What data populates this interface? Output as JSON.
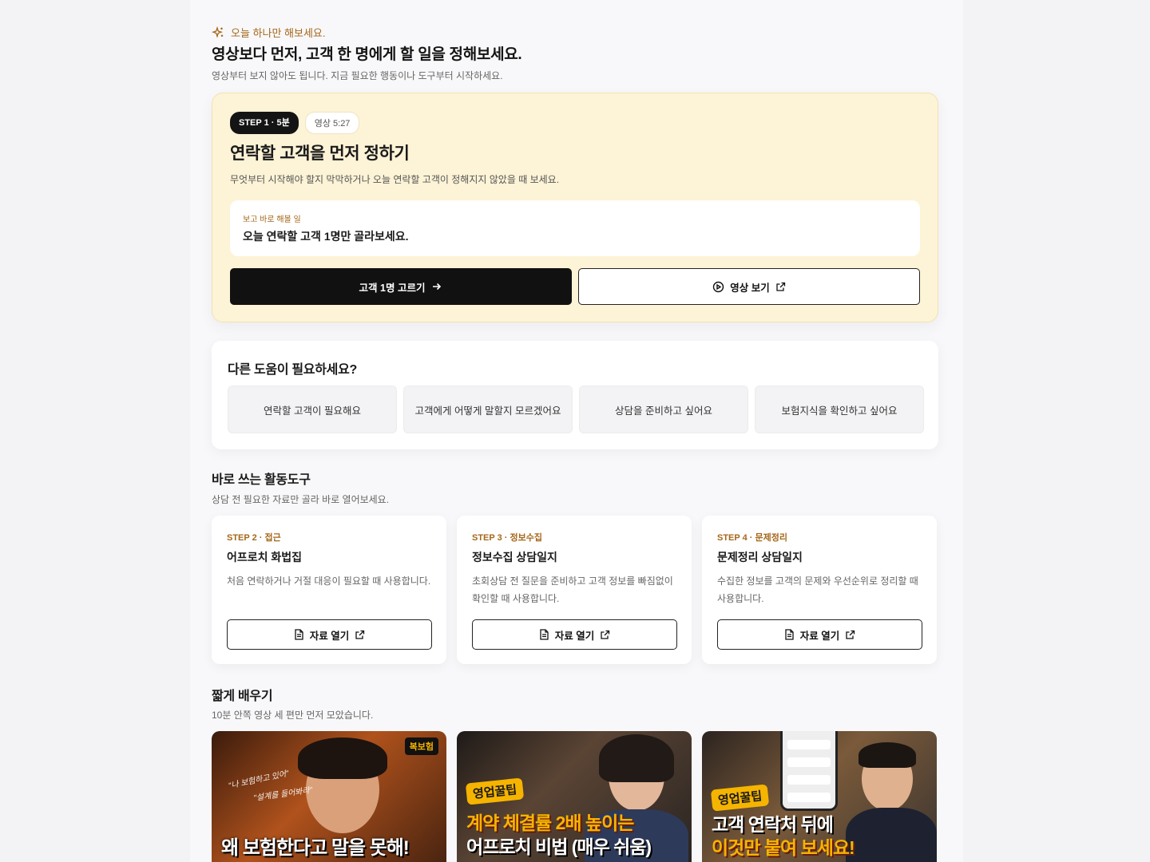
{
  "hero": {
    "eyebrow": "오늘 하나만 해보세요.",
    "title": "영상보다 먼저, 고객 한 명에게 할 일을 정해보세요.",
    "subtitle": "영상부터 보지 않아도 됩니다. 지금 필요한 행동이나 도구부터 시작하세요."
  },
  "step": {
    "chip": "STEP 1 · 5분",
    "video_chip": "영상 5:27",
    "title": "연락할 고객을 먼저 정하기",
    "desc": "무엇부터 시작해야 할지 막막하거나 오늘 연락할 고객이 정해지지 않았을 때 보세요.",
    "todo_label": "보고 바로 해볼 일",
    "todo_text": "오늘 연락할 고객 1명만 골라보세요.",
    "primary_button": "고객 1명 고르기",
    "secondary_button": "영상 보기"
  },
  "help": {
    "title": "다른 도움이 필요하세요?",
    "options": [
      "연락할 고객이 필요해요",
      "고객에게 어떻게 말할지 모르겠어요",
      "상담을 준비하고 싶어요",
      "보험지식을 확인하고 싶어요"
    ]
  },
  "tools": {
    "title": "바로 쓰는 활동도구",
    "subtitle": "상담 전 필요한 자료만 골라 바로 열어보세요.",
    "items": [
      {
        "step": "STEP 2 · 접근",
        "name": "어프로치 화법집",
        "desc": "처음 연락하거나 거절 대응이 필요할 때 사용합니다.",
        "button": "자료 열기"
      },
      {
        "step": "STEP 3 · 정보수집",
        "name": "정보수집 상담일지",
        "desc": "초회상담 전 질문을 준비하고 고객 정보를 빠짐없이 확인할 때 사용합니다.",
        "button": "자료 열기"
      },
      {
        "step": "STEP 4 · 문제정리",
        "name": "문제정리 상담일지",
        "desc": "수집한 정보를 고객의 문제와 우선순위로 정리할 때 사용합니다.",
        "button": "자료 열기"
      }
    ]
  },
  "videos": {
    "title": "짧게 배우기",
    "subtitle": "10분 안쪽 영상 세 편만 먼저 모았습니다.",
    "items": [
      {
        "logo": "복보험",
        "note1": "\"나 보험하고 있어\"",
        "note2": "\"설계를 들어봐라\"",
        "line1": "왜 보험한다고 말을 못해!"
      },
      {
        "tag": "영업꿀팁",
        "line1": "계약 체결률 2배 높이는",
        "line2": "어프로치 비법 (매우 쉬움)"
      },
      {
        "tag": "영업꿀팁",
        "line1": "고객 연락처 뒤에",
        "line2": "이것만 붙여 보세요!"
      }
    ]
  },
  "colors": {
    "accent": "#a5671a",
    "highlight_bg": "#fdf3d6",
    "thumb_yellow": "#f5b400"
  }
}
